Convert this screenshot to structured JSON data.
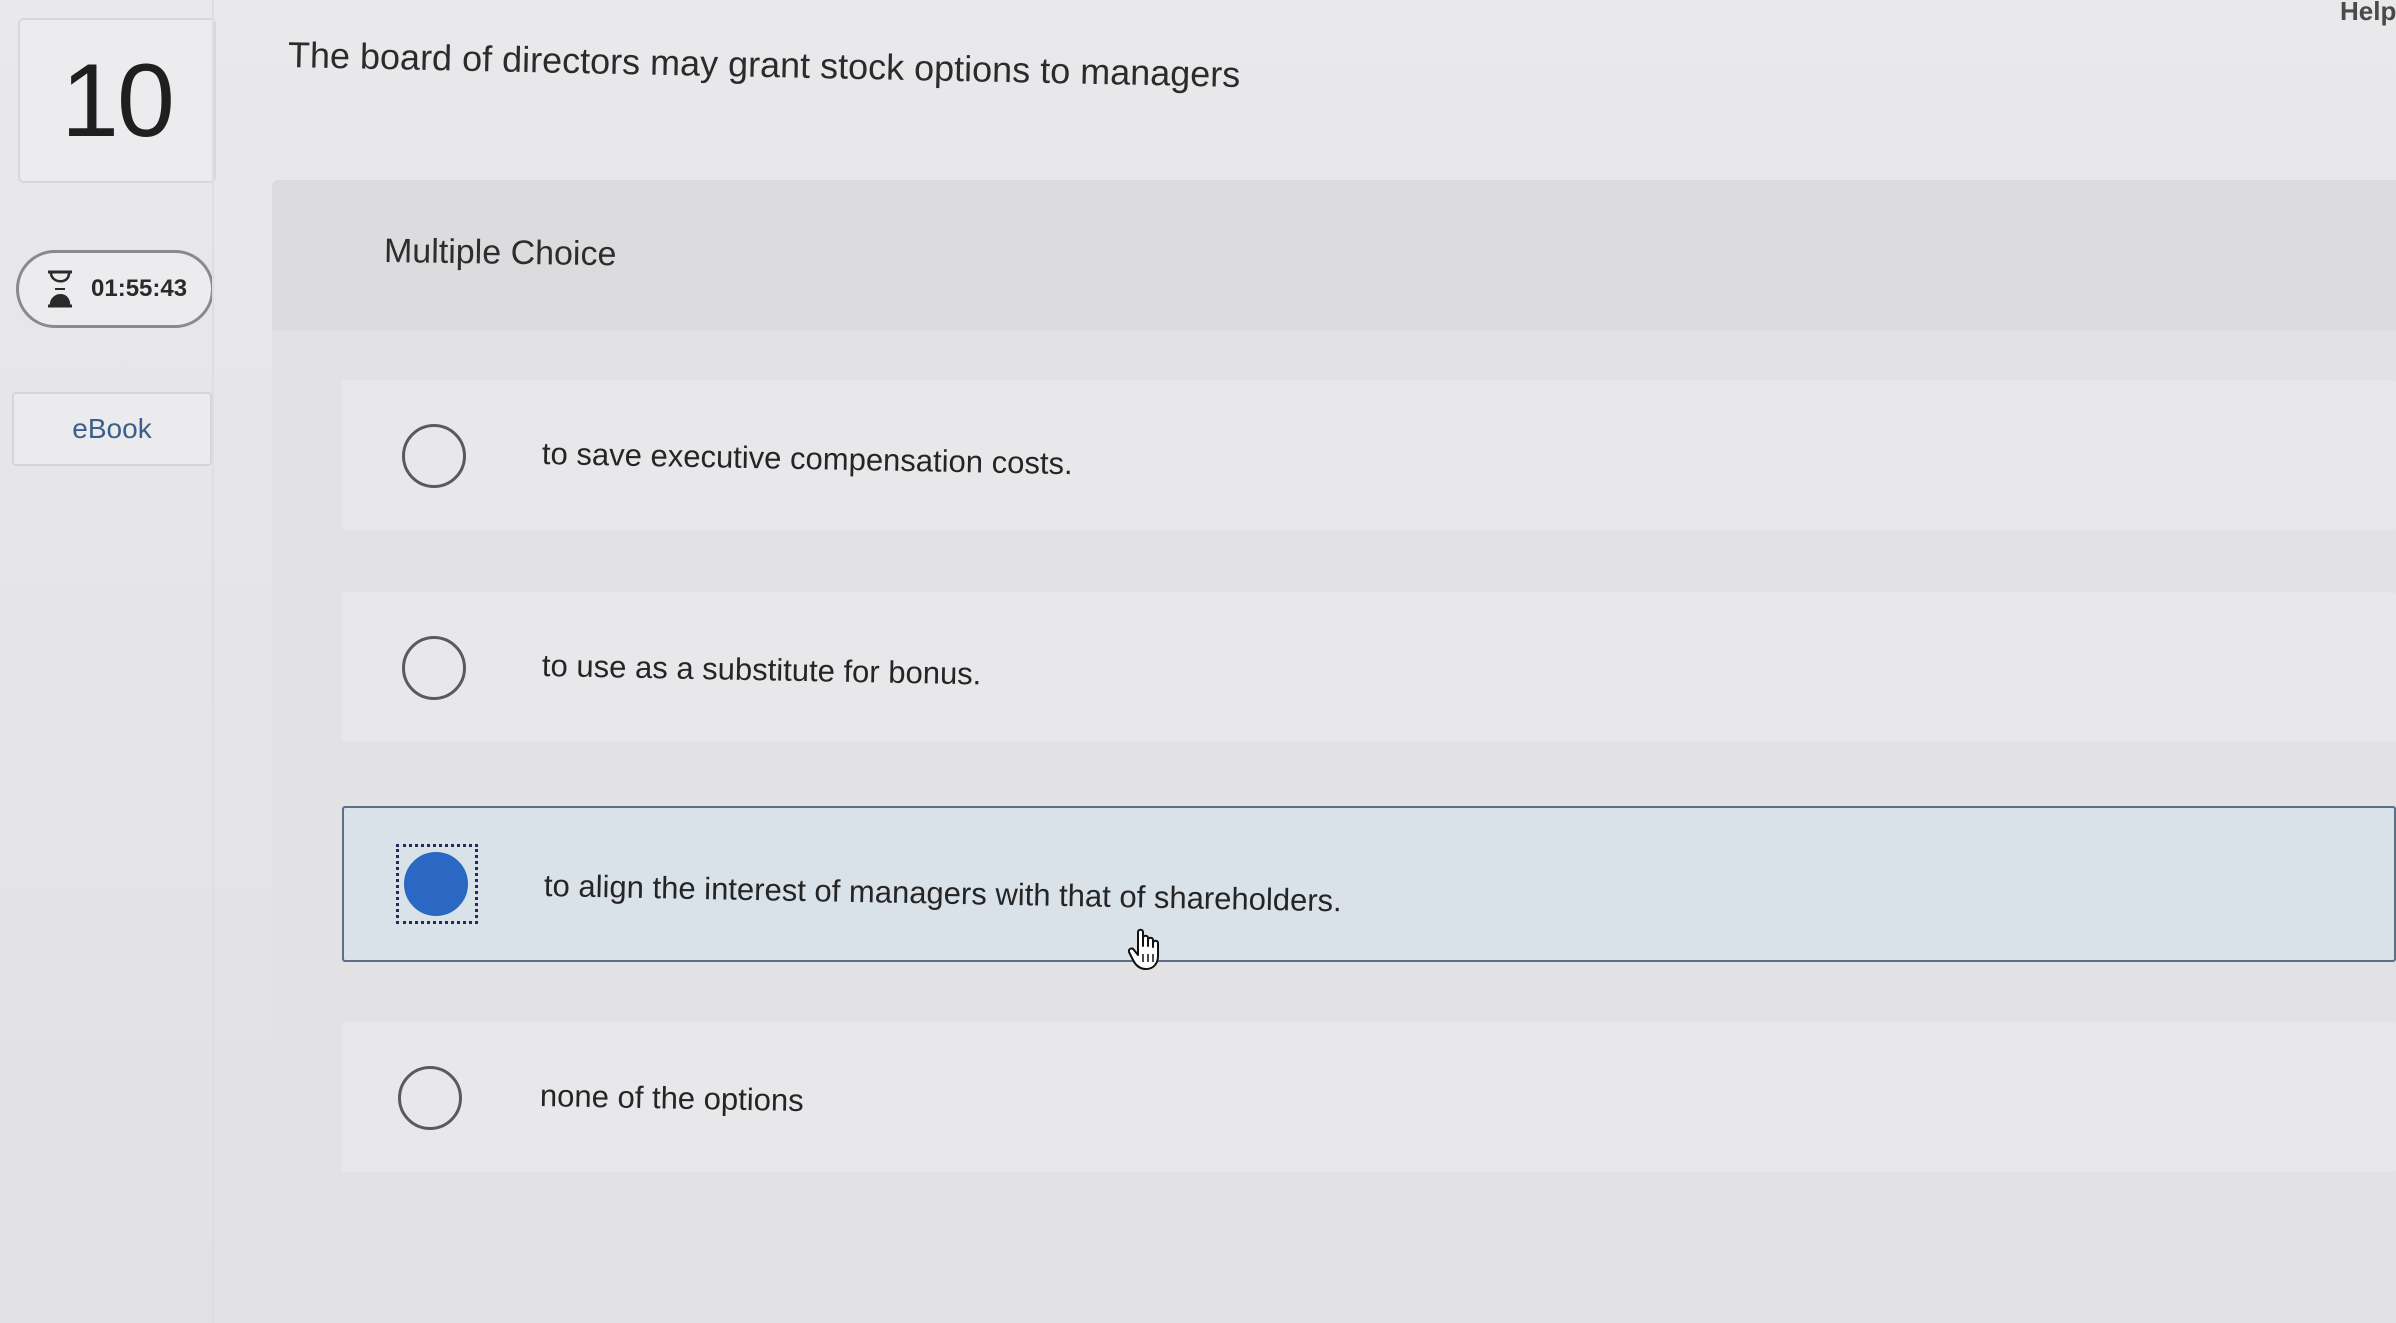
{
  "question": {
    "number": "10",
    "prompt": "The board of directors may grant stock options to managers"
  },
  "header": {
    "help_label": "Help"
  },
  "timer": {
    "icon": "hourglass-icon",
    "time": "01:55:43"
  },
  "sidebar": {
    "ebook_label": "eBook"
  },
  "panel": {
    "type_label": "Multiple Choice"
  },
  "options": [
    {
      "label": "to save executive compensation costs.",
      "selected": false
    },
    {
      "label": "to use as a substitute for bonus.",
      "selected": false
    },
    {
      "label": "to align the interest of managers with that of shareholders.",
      "selected": true
    },
    {
      "label": "none of the options",
      "selected": false
    }
  ],
  "colors": {
    "selected_fill": "#2a68c4",
    "selected_row_bg": "#d9e1e9",
    "ebook_text": "#3a5f8a"
  }
}
